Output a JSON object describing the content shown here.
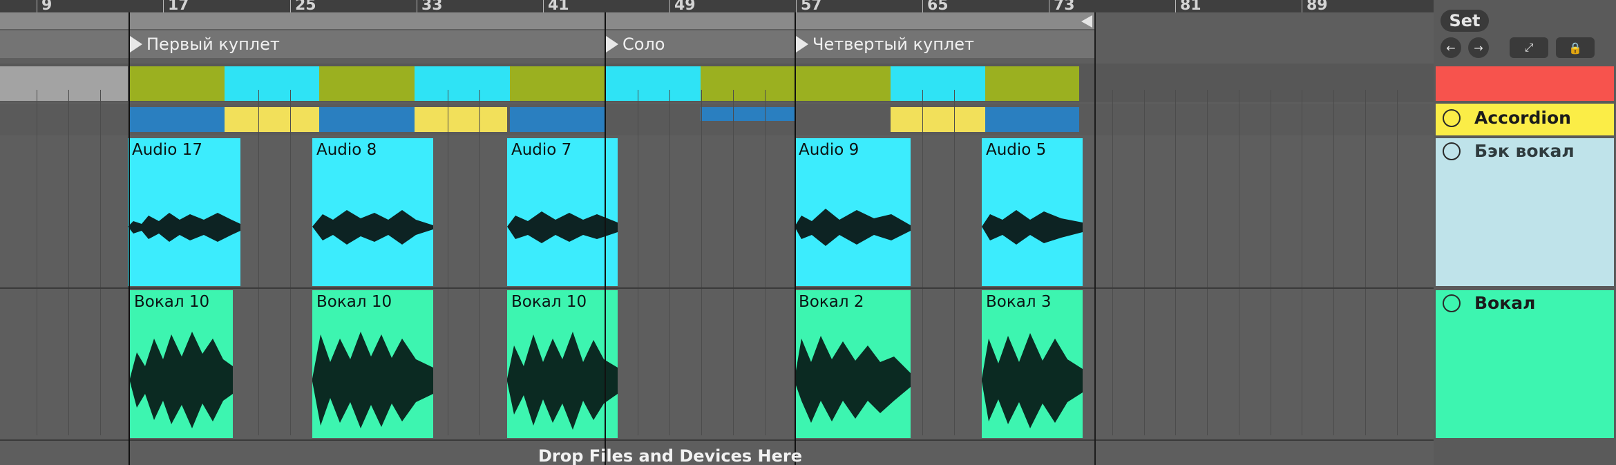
{
  "ruler": {
    "marks": [
      "9",
      "17",
      "25",
      "33",
      "41",
      "49",
      "57",
      "65",
      "73",
      "81",
      "89"
    ]
  },
  "locators": [
    {
      "label": "Первый куплет"
    },
    {
      "label": "Соло"
    },
    {
      "label": "Четвертый куплет"
    }
  ],
  "tracks": {
    "back_vocal": {
      "name": "Бэк вокал",
      "clips": [
        "Audio 17",
        "Audio 8",
        "Audio 7",
        "Audio 9",
        "Audio 5"
      ]
    },
    "vocal": {
      "name": "Вокал",
      "clips": [
        "Вокал 10",
        "Вокал 10",
        "Вокал 10",
        "Вокал 2",
        "Вокал 3"
      ]
    },
    "accordion": {
      "name": "Accordion"
    }
  },
  "top_panel": {
    "set_label": "Set"
  },
  "drop_zone": {
    "text": "Drop Files and Devices Here"
  },
  "colors": {
    "back_vocal": "#3cecfd",
    "vocal": "#3df5b0",
    "olive": "#9bb020",
    "cyan": "#2fe3f5",
    "accordion": "#fbed47",
    "red_track": "#f7534d",
    "blue": "#2a7fc0",
    "yellow": "#f2e05a"
  }
}
